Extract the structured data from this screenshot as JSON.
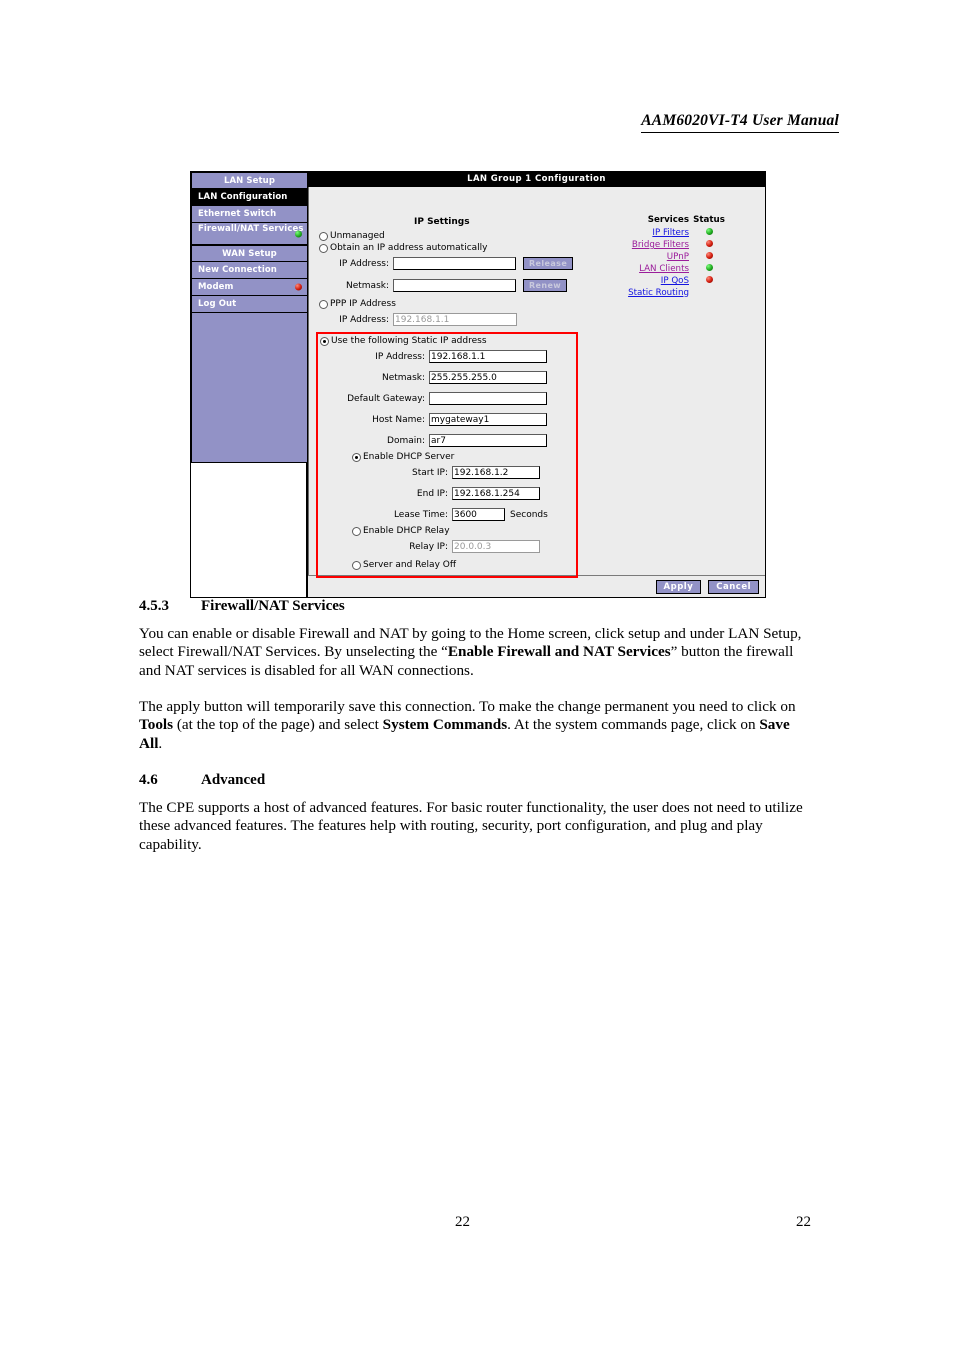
{
  "document": {
    "header_title": "AAM6020VI-T4 User Manual",
    "page_number_left": "22",
    "page_number_right": "22"
  },
  "screenshot": {
    "title_bar": "LAN Group 1 Configuration",
    "sidebar": {
      "items": [
        {
          "label": "LAN Setup",
          "type": "header",
          "led": "none",
          "active": false
        },
        {
          "label": "LAN Configuration",
          "type": "item",
          "led": "none",
          "active": true
        },
        {
          "label": "Ethernet Switch",
          "type": "item",
          "led": "none",
          "active": false
        },
        {
          "label": "Firewall/NAT Services",
          "type": "item",
          "led": "green",
          "active": false
        },
        {
          "label": "WAN Setup",
          "type": "header",
          "led": "none",
          "active": false
        },
        {
          "label": "New Connection",
          "type": "item",
          "led": "none",
          "active": false
        },
        {
          "label": "Modem",
          "type": "item",
          "led": "red",
          "active": false
        },
        {
          "label": "Log Out",
          "type": "item",
          "led": "none",
          "active": false
        }
      ]
    },
    "form": {
      "section_title": "IP Settings",
      "mode_unmanaged_label": "Unmanaged",
      "mode_unmanaged_selected": false,
      "mode_auto_label": "Obtain an IP address automatically",
      "mode_auto_selected": false,
      "auto_ip_label": "IP Address:",
      "auto_ip_value": "",
      "auto_netmask_label": "Netmask:",
      "auto_netmask_value": "",
      "release_button": "Release",
      "renew_button": "Renew",
      "mode_ppp_label": "PPP IP Address",
      "mode_ppp_selected": false,
      "ppp_ip_label": "IP Address:",
      "ppp_ip_value": "192.168.1.1",
      "mode_static_label": "Use the following Static IP address",
      "mode_static_selected": true,
      "static_ip_label": "IP Address:",
      "static_ip_value": "192.168.1.1",
      "static_netmask_label": "Netmask:",
      "static_netmask_value": "255.255.255.0",
      "gateway_label": "Default Gateway:",
      "gateway_value": "",
      "hostname_label": "Host Name:",
      "hostname_value": "mygateway1",
      "domain_label": "Domain:",
      "domain_value": "ar7",
      "dhcp_server_label": "Enable DHCP Server",
      "dhcp_server_selected": true,
      "start_ip_label": "Start IP:",
      "start_ip_value": "192.168.1.2",
      "end_ip_label": "End IP:",
      "end_ip_value": "192.168.1.254",
      "lease_time_label": "Lease Time:",
      "lease_time_value": "3600",
      "lease_time_unit": "Seconds",
      "dhcp_relay_label": "Enable DHCP Relay",
      "dhcp_relay_selected": false,
      "relay_ip_label": "Relay IP:",
      "relay_ip_value": "20.0.0.3",
      "server_relay_off_label": "Server and Relay Off",
      "server_relay_off_selected": false
    },
    "services_panel": {
      "col_service": "Services",
      "col_status": "Status",
      "rows": [
        {
          "name": "IP Filters",
          "link_color": "#1414e0",
          "status": "green"
        },
        {
          "name": "Bridge Filters",
          "link_color": "#9b1d9b",
          "status": "red"
        },
        {
          "name": "UPnP",
          "link_color": "#9b1d9b",
          "status": "red"
        },
        {
          "name": "LAN Clients",
          "link_color": "#9b1d9b",
          "status": "green"
        },
        {
          "name": "IP QoS",
          "link_color": "#1414e0",
          "status": "red"
        },
        {
          "name": "Static Routing",
          "link_color": "#1414e0",
          "status": "none"
        }
      ]
    },
    "footer": {
      "apply_button": "Apply",
      "cancel_button": "Cancel"
    },
    "highlight_color": "#fe0000"
  },
  "sections": {
    "s453": {
      "number": "4.5.3",
      "title": "Firewall/NAT Services",
      "p1_a": "You can enable or disable Firewall and NAT by going to the Home screen, click setup and under LAN Setup, select Firewall/NAT Services.  By unselecting the “",
      "p1_b": "Enable Firewall and NAT Services",
      "p1_c": "” button the firewall and NAT services is disabled for all WAN connections.",
      "p2_a": "The apply button will temporarily save this connection. To make the change permanent you need to click on ",
      "p2_b": "Tools",
      "p2_c": " (at the top of the page) and select ",
      "p2_d": "System Commands",
      "p2_e": ".  At the system commands page, click on ",
      "p2_f": "Save All",
      "p2_g": "."
    },
    "s46": {
      "number": "4.6",
      "title": "Advanced",
      "p1": "The CPE supports a host of advanced features.  For basic router functionality, the user does not need to utilize these advanced features.  The features help with routing, security, port configuration, and plug and play capability."
    }
  }
}
